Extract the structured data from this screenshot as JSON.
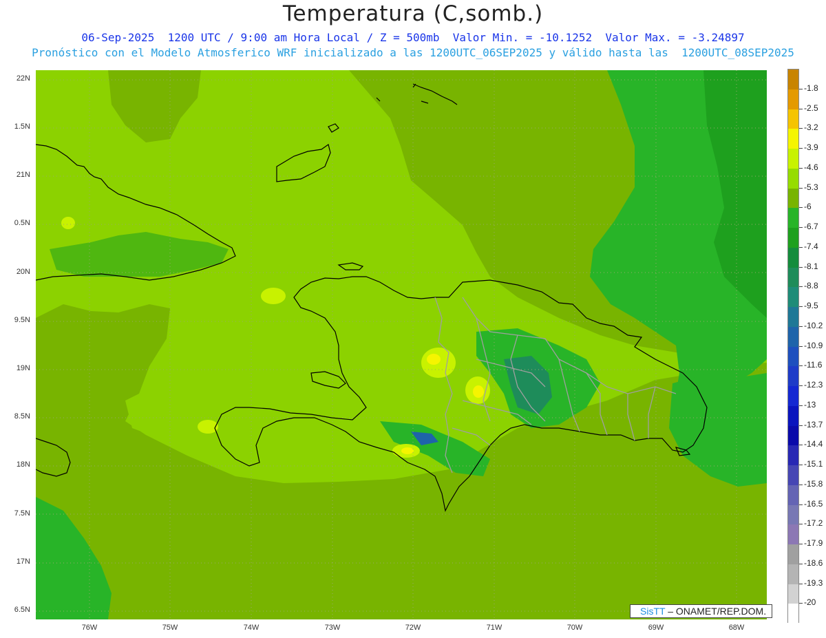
{
  "header": {
    "title": "Temperatura (C,somb.)",
    "line1": "06-Sep-2025  1200 UTC / 9:00 am Hora Local / Z = 500mb  Valor Min. = -10.1252  Valor Max. = -3.24897",
    "line2": "Pronóstico con el Modelo Atmosferico WRF inicializado a las 1200UTC_06SEP2025 y válido hasta las  1200UTC_08SEP2025"
  },
  "axes": {
    "lat_labels": [
      "22N",
      "1.5N",
      "21N",
      "0.5N",
      "20N",
      "9.5N",
      "19N",
      "8.5N",
      "18N",
      "7.5N",
      "17N",
      "6.5N"
    ],
    "lon_labels": [
      "76W",
      "75W",
      "74W",
      "73W",
      "72W",
      "71W",
      "70W",
      "69W",
      "68W"
    ]
  },
  "colorbar": {
    "labels": [
      "-1.8",
      "-2.5",
      "-3.2",
      "-3.9",
      "-4.6",
      "-5.3",
      "-6",
      "-6.7",
      "-7.4",
      "-8.1",
      "-8.8",
      "-9.5",
      "-10.2",
      "-10.9",
      "-11.6",
      "-12.3",
      "-13",
      "-13.7",
      "-14.4",
      "-15.1",
      "-15.8",
      "-16.5",
      "-17.2",
      "-17.9",
      "-18.6",
      "-19.3",
      "-20"
    ],
    "colors": [
      "#c88400",
      "#e49a00",
      "#f5c400",
      "#f5f500",
      "#c8f200",
      "#96dc00",
      "#78b400",
      "#28b428",
      "#1ea01e",
      "#148c3c",
      "#1e8c5a",
      "#1e8c78",
      "#1e7896",
      "#1e64aa",
      "#1e50be",
      "#1e3cc8",
      "#1428d2",
      "#0a14be",
      "#0a0aaa",
      "#2828b4",
      "#4646b4",
      "#6464b4",
      "#7878b4",
      "#8c78b4",
      "#a0a0a0",
      "#b4b4b4",
      "#d2d2d2",
      "#ffffff"
    ]
  },
  "field_colors": {
    "lime": "#8cd200",
    "olive": "#78b400",
    "green": "#28b428",
    "dark_green": "#1ea01e",
    "teal": "#1e8c5a",
    "yellow_green": "#c8f200",
    "yellow": "#f5f500",
    "blue": "#1e64aa",
    "coast": "#000000",
    "borders": "#a0a0a0"
  },
  "credit": {
    "brand": "SisTT",
    "rest": " – ONAMET/REP.DOM."
  }
}
